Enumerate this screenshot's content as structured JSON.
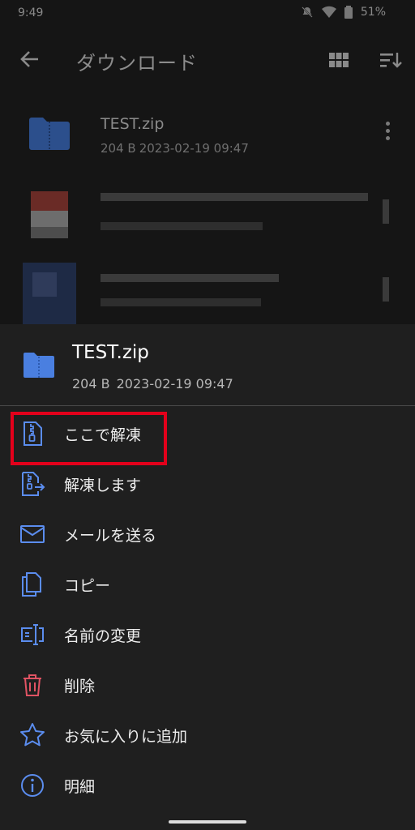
{
  "status_bar": {
    "time": "9:49",
    "battery": "51%"
  },
  "app_bar": {
    "title": "ダウンロード"
  },
  "files": [
    {
      "name": "TEST.zip",
      "size": "204 B",
      "date": "2023-02-19 09:47"
    }
  ],
  "sheet": {
    "file_name": "TEST.zip",
    "file_size": "204 B",
    "file_date": "2023-02-19 09:47",
    "menu": [
      {
        "label": "ここで解凍",
        "icon": "zip-file-icon"
      },
      {
        "label": "解凍します",
        "icon": "extract-icon"
      },
      {
        "label": "メールを送る",
        "icon": "mail-icon"
      },
      {
        "label": "コピー",
        "icon": "copy-icon"
      },
      {
        "label": "名前の変更",
        "icon": "rename-icon"
      },
      {
        "label": "削除",
        "icon": "trash-icon"
      },
      {
        "label": "お気に入りに追加",
        "icon": "star-icon"
      },
      {
        "label": "明細",
        "icon": "info-icon"
      }
    ]
  },
  "colors": {
    "accent": "#5b8def",
    "delete": "#e05363",
    "highlight_box": "#e3001b",
    "folder_blue": "#4a7fe0"
  }
}
